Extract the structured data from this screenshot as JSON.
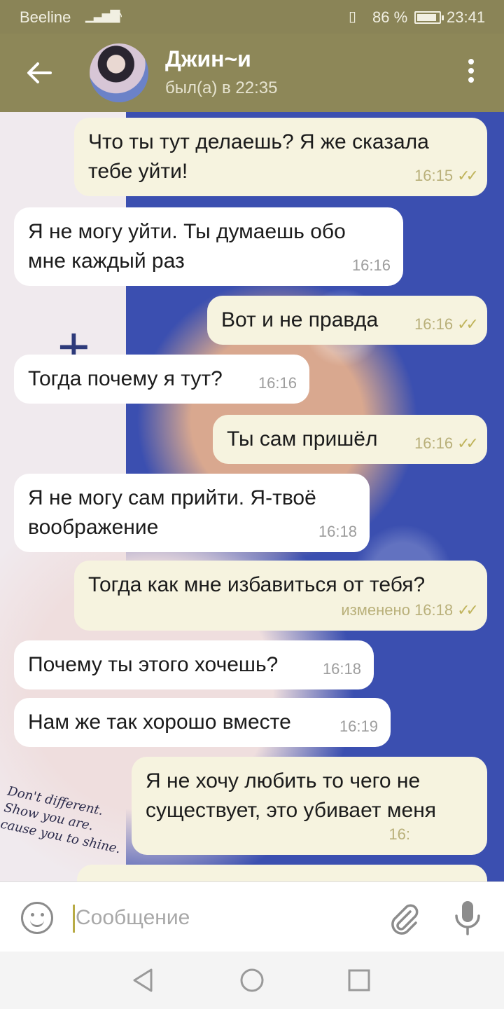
{
  "status_bar": {
    "carrier": "Beeline",
    "battery": "86 %",
    "time": "23:41"
  },
  "header": {
    "name": "Джин~и",
    "last_seen": "был(а) в 22:35"
  },
  "messages": [
    {
      "dir": "out",
      "text": "Что ты тут делаешь? Я же сказала тебе уйти!",
      "time": "16:15",
      "edited": ""
    },
    {
      "dir": "in",
      "text": "Я не могу уйти. Ты думаешь обо мне каждый раз",
      "time": "16:16",
      "edited": ""
    },
    {
      "dir": "out",
      "text": "Вот и не правда",
      "time": "16:16",
      "edited": ""
    },
    {
      "dir": "in",
      "text": "Тогда почему я тут?",
      "time": "16:16",
      "edited": ""
    },
    {
      "dir": "out",
      "text": "Ты сам пришёл",
      "time": "16:16",
      "edited": ""
    },
    {
      "dir": "in",
      "text": "Я не могу сам прийти. Я-твоё воображение",
      "time": "16:18",
      "edited": ""
    },
    {
      "dir": "out",
      "text": "Тогда как мне избавиться от тебя?",
      "time": "16:18",
      "edited": "изменено"
    },
    {
      "dir": "in",
      "text": "Почему ты этого хочешь?",
      "time": "16:18",
      "edited": ""
    },
    {
      "dir": "in",
      "text": "Нам же так хорошо вместе",
      "time": "16:19",
      "edited": ""
    },
    {
      "dir": "out",
      "text": "Я не хочу любить то чего не существует, это убивает меня",
      "time": "16:",
      "edited": ""
    }
  ],
  "background_text": [
    "Don't different.",
    "Show you are.",
    "cause you to shine."
  ],
  "input": {
    "placeholder": "Сообщение"
  },
  "icons": {
    "back": "arrow-left-icon",
    "menu": "more-vert-icon",
    "emoji": "smile-icon",
    "attach": "paperclip-icon",
    "mic": "microphone-icon",
    "scroll": "chevron-down-icon",
    "nav_back": "triangle-back-icon",
    "nav_home": "circle-home-icon",
    "nav_recent": "square-recent-icon"
  },
  "colors": {
    "header": "#8d8758",
    "outgoing_bubble": "#f6f3df",
    "incoming_bubble": "#ffffff",
    "checks": "#c0b45c"
  }
}
